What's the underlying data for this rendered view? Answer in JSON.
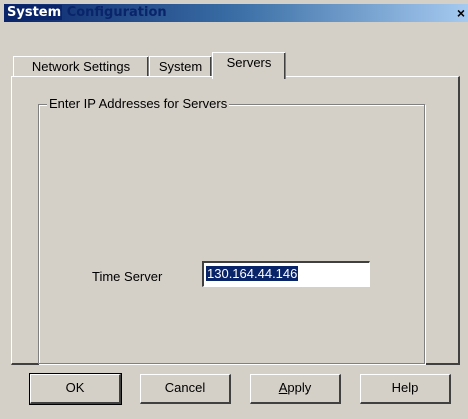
{
  "window": {
    "title_part1": "System",
    "title_part2": "Configuration",
    "close_glyph": "×"
  },
  "tabs": [
    {
      "label": "Network Settings",
      "active": false
    },
    {
      "label": "System",
      "active": false
    },
    {
      "label": "Servers",
      "active": true
    }
  ],
  "servers": {
    "group_title": "Enter IP Addresses for Servers",
    "time_server_label": "Time Server",
    "time_server_value": "130.164.44.146"
  },
  "buttons": {
    "ok": "OK",
    "cancel": "Cancel",
    "apply_mnemonic": "A",
    "apply_rest": "pply",
    "help": "Help"
  },
  "colors": {
    "face": "#d4d0c8",
    "title_dark": "#0a246a",
    "selection": "#0a246a"
  }
}
